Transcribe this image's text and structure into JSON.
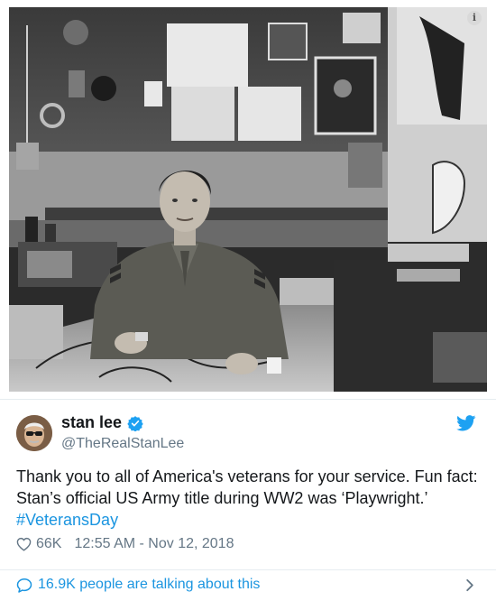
{
  "photo": {
    "info_badge": "i",
    "description_icon": "info-icon"
  },
  "tweet": {
    "author_name": "stan lee",
    "handle": "@TheRealStanLee",
    "verified": true,
    "text_lines": [
      "Thank you to all of America's veterans for your service. Fun fact:",
      "Stan’s official US Army title during WW2 was ‘Playwright.’"
    ],
    "hashtag": "#VeteransDay",
    "likes": "66K",
    "timestamp": "12:55 AM - Nov 12, 2018"
  },
  "footer": {
    "count": "16.9K",
    "talking_text": " people are talking about this"
  },
  "colors": {
    "link_blue": "#1b95e0",
    "muted_gray": "#657786",
    "verified_blue": "#1da1f2",
    "divider": "#e6ecf0"
  }
}
